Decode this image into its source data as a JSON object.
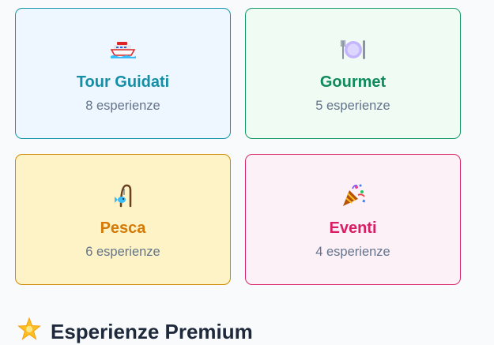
{
  "categories": [
    {
      "icon": "ship-icon",
      "title": "Tour Guidati",
      "count": "8 esperienze",
      "accent": "#148fa6"
    },
    {
      "icon": "plate-icon",
      "title": "Gourmet",
      "count": "5 esperienze",
      "accent": "#0f8a5e"
    },
    {
      "icon": "fishing-rod-icon",
      "title": "Pesca",
      "count": "6 esperienze",
      "accent": "#d57a06"
    },
    {
      "icon": "party-popper-icon",
      "title": "Eventi",
      "count": "4 esperienze",
      "accent": "#d81f64"
    }
  ],
  "premium": {
    "icon": "star-icon",
    "title": "Esperienze Premium"
  }
}
